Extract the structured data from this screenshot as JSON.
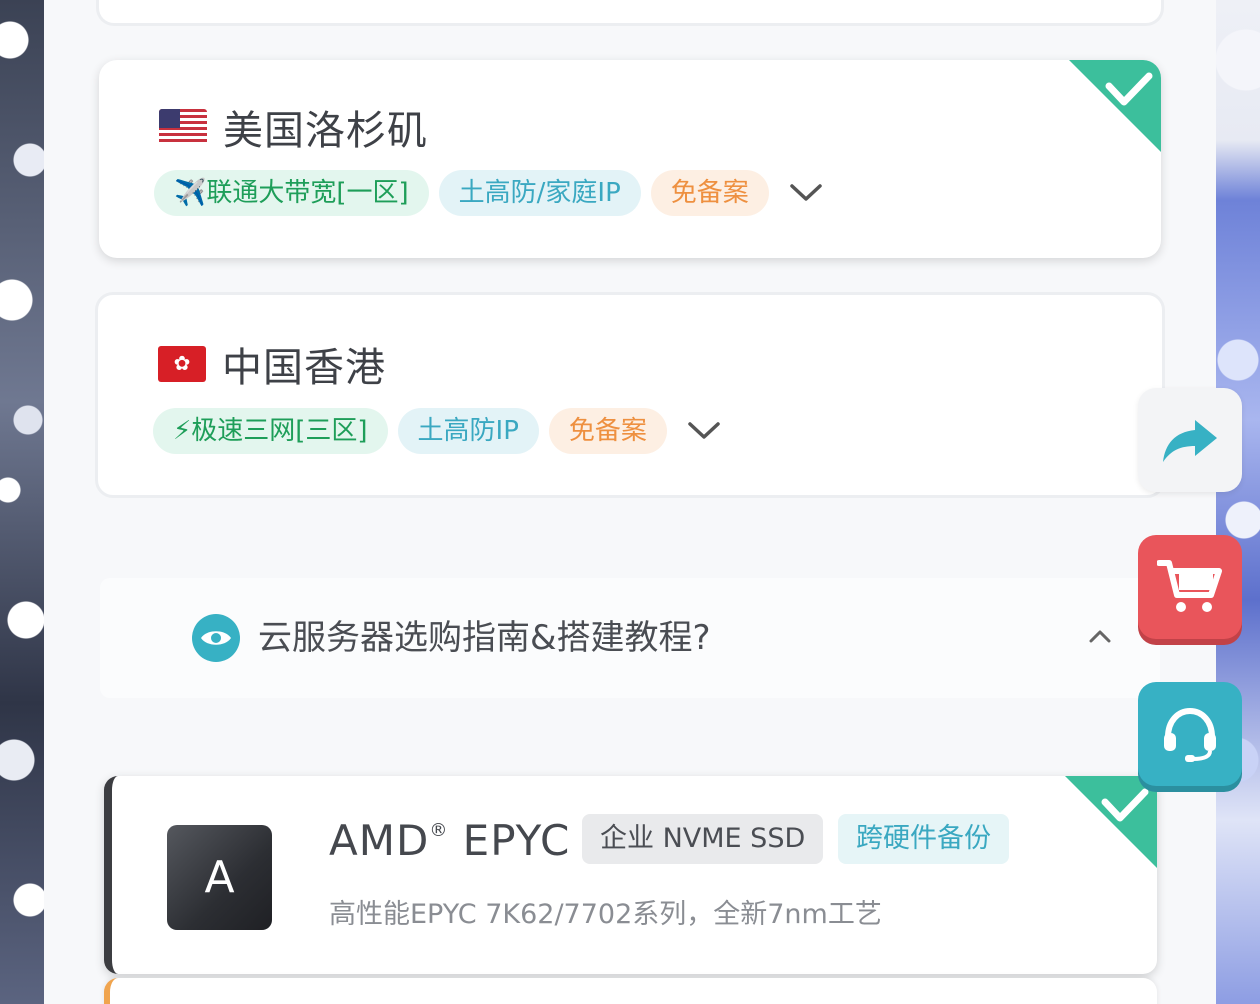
{
  "regions": [
    {
      "name": "美国洛杉矶",
      "flag_icon": "us-flag-icon",
      "selected": true,
      "tags": [
        {
          "label": "✈️联通大带宽[一区]",
          "style": "green"
        },
        {
          "label": "土高防/家庭IP",
          "style": "cyan"
        },
        {
          "label": "免备案",
          "style": "orange"
        }
      ]
    },
    {
      "name": "中国香港",
      "flag_icon": "hk-flag-icon",
      "selected": false,
      "tags": [
        {
          "label": "⚡极速三网[三区]",
          "style": "green"
        },
        {
          "label": "土高防IP",
          "style": "cyan"
        },
        {
          "label": "免备案",
          "style": "orange"
        }
      ]
    }
  ],
  "guide": {
    "title": "云服务器选购指南&搭建教程?",
    "icon": "eye-icon"
  },
  "cpu": {
    "logo_letter": "A",
    "name": "AMD",
    "trademark": "®",
    "name_suffix": "EPYC",
    "tags": [
      "企业 NVME SSD",
      "跨硬件备份"
    ],
    "description": "高性能EPYC 7K62/7702系列，全新7nm工艺",
    "selected": true
  },
  "floating": {
    "share_icon": "share-arrow-icon",
    "cart_icon": "shopping-cart-icon",
    "support_icon": "headset-icon"
  },
  "colors": {
    "accent_teal": "#37b1c4",
    "check_green": "#3cbf9c",
    "cart_red": "#e9555b"
  }
}
